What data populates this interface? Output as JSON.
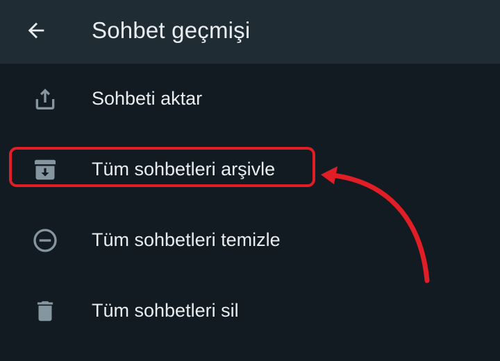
{
  "header": {
    "title": "Sohbet geçmişi",
    "back_icon": "arrow-left-icon"
  },
  "menu": {
    "items": [
      {
        "label": "Sohbeti aktar",
        "icon": "share-upload-icon"
      },
      {
        "label": "Tüm sohbetleri arşivle",
        "icon": "archive-icon"
      },
      {
        "label": "Tüm sohbetleri temizle",
        "icon": "minus-circle-icon"
      },
      {
        "label": "Tüm sohbetleri sil",
        "icon": "trash-icon"
      }
    ]
  },
  "annotation": {
    "highlighted_item": "Tüm sohbetleri arşivle",
    "color": "#e11d25"
  },
  "colors": {
    "background": "#121b22",
    "header": "#1f2c34",
    "text": "#e9edef",
    "icon": "#8696a0"
  }
}
